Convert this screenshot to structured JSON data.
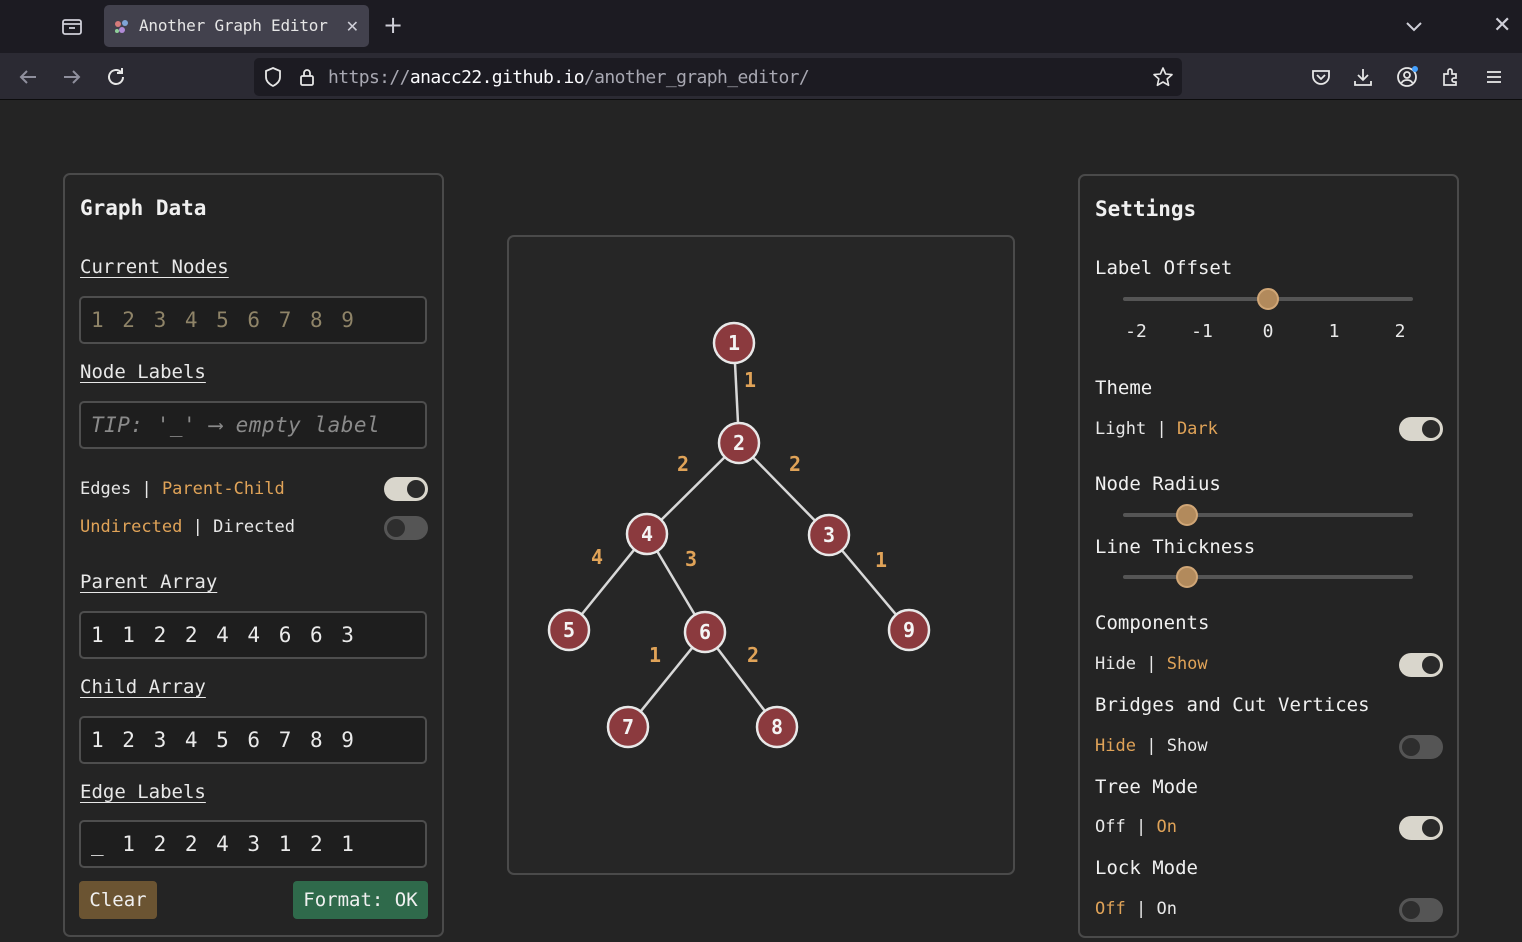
{
  "browser": {
    "tab_title": "Another Graph Editor",
    "url_prefix": "https://",
    "url_host": "anacc22.github.io",
    "url_path": "/another_graph_editor/"
  },
  "graph_data_panel": {
    "title": "Graph Data",
    "current_nodes_label": "Current Nodes",
    "current_nodes_value": "1 2 3 4 5 6 7 8 9",
    "node_labels_label": "Node Labels",
    "node_labels_placeholder": "TIP: '_' ⟶ empty label",
    "edges_toggle": {
      "left": "Edges",
      "sep": "|",
      "right": "Parent-Child",
      "on": true
    },
    "direction_toggle": {
      "left": "Undirected",
      "sep": "|",
      "right": "Directed",
      "on": false
    },
    "parent_array_label": "Parent Array",
    "parent_array_value": "1 1 2 2 4 4 6 6 3",
    "child_array_label": "Child Array",
    "child_array_value": "1 2 3 4 5 6 7 8 9",
    "edge_labels_label": "Edge Labels",
    "edge_labels_value": "_ 1 2 2 4 3 1 2 1",
    "clear_button": "Clear",
    "format_button": "Format: OK"
  },
  "graph": {
    "nodes": [
      {
        "id": "1"
      },
      {
        "id": "2"
      },
      {
        "id": "3"
      },
      {
        "id": "4"
      },
      {
        "id": "5"
      },
      {
        "id": "6"
      },
      {
        "id": "7"
      },
      {
        "id": "8"
      },
      {
        "id": "9"
      }
    ],
    "edges": [
      {
        "from": "1",
        "to": "2",
        "label": "1"
      },
      {
        "from": "2",
        "to": "4",
        "label": "2"
      },
      {
        "from": "2",
        "to": "3",
        "label": "2"
      },
      {
        "from": "4",
        "to": "5",
        "label": "4"
      },
      {
        "from": "4",
        "to": "6",
        "label": "3"
      },
      {
        "from": "6",
        "to": "7",
        "label": "1"
      },
      {
        "from": "6",
        "to": "8",
        "label": "2"
      },
      {
        "from": "3",
        "to": "9",
        "label": "1"
      }
    ],
    "node_color": "#8b3a3e",
    "edge_label_color": "#e0a358"
  },
  "settings_panel": {
    "title": "Settings",
    "label_offset_label": "Label Offset",
    "label_offset_ticks": [
      "-2",
      "-1",
      "0",
      "1",
      "2"
    ],
    "label_offset_value": 0,
    "theme_label": "Theme",
    "theme_toggle": {
      "left": "Light",
      "sep": "|",
      "right": "Dark",
      "on": true
    },
    "node_radius_label": "Node Radius",
    "node_radius_fraction": 0.22,
    "line_thickness_label": "Line Thickness",
    "line_thickness_fraction": 0.22,
    "components_label": "Components",
    "components_toggle": {
      "left": "Hide",
      "sep": "|",
      "right": "Show",
      "on": true
    },
    "bridges_label": "Bridges and Cut Vertices",
    "bridges_toggle": {
      "left": "Hide",
      "sep": "|",
      "right": "Show",
      "on": false
    },
    "tree_mode_label": "Tree Mode",
    "tree_mode_toggle": {
      "left": "Off",
      "sep": "|",
      "right": "On",
      "on": true
    },
    "lock_mode_label": "Lock Mode",
    "lock_mode_toggle": {
      "left": "Off",
      "sep": "|",
      "right": "On",
      "on": false
    }
  },
  "colors": {
    "accent": "#e0a358",
    "clear_button_bg": "#6b5432",
    "format_button_bg": "#2f6a4b",
    "slider_thumb": "#b28a5c"
  }
}
